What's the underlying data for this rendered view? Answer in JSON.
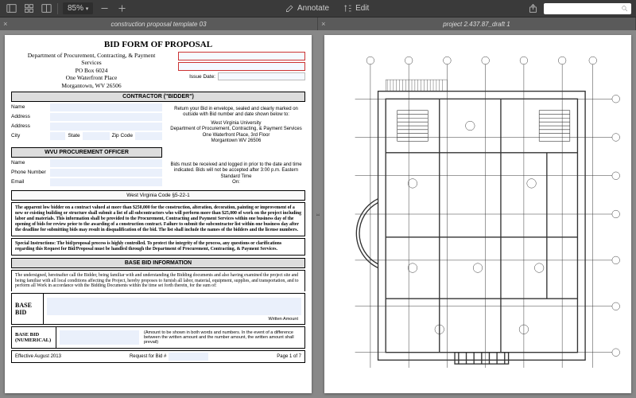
{
  "toolbar": {
    "zoom": "85%",
    "annotate": "Annotate",
    "edit": "Edit"
  },
  "tabs": [
    {
      "title": "construction proposal template 03"
    },
    {
      "title": "project 2.437.87_draft 1"
    }
  ],
  "doc": {
    "title": "BID FORM OF PROPOSAL",
    "dept_lines": [
      "Department of Procurement, Contracting, & Payment",
      "Services",
      "PO Box 6024",
      "One Waterfront Place",
      "Morgantown, WV 26506"
    ],
    "issue_date_label": "Issue Date:",
    "contractor_hdr": "CONTRACTOR (\"BIDDER\")",
    "labels": {
      "name": "Name",
      "address": "Address",
      "city": "City",
      "state": "State",
      "zip": "Zip Code",
      "phone": "Phone Number",
      "email": "Email"
    },
    "return_text": "Return your Bid in envelope, sealed and clearly marked on outside with Bid number and date shown below to:",
    "return_addr": [
      "West Virginia University",
      "Department of Procurement, Contracting, & Payment Services",
      "One Waterfront Place, 3rd Floor",
      "Morgantown WV 26506"
    ],
    "deadline_text": "Bids must be received and logged in prior to the date and time indicated.  Bids will not be accepted after 3:00 p.m. Eastern Standard Time",
    "deadline_on": "On:",
    "officer_hdr": "WVU PROCUREMENT OFFICER",
    "code": "West Virginia Code §5-22-1",
    "para1": "The apparent low bidder on a contract valued at more than $250,000 for the construction, alteration, decoration, painting or improvement of a new or existing building or structure shall submit a list of all subcontractors who will perform more than $25,000 of work on the project including labor and materials. This information shall be provided to the Procurement, Contracting and Payment Services within one business day of the opening of bids for review prior to the awarding of a construction contract. Failure to submit the subcontractor list within one business day after the deadline for submitting bids may result in disqualification of the bid. The list shall include the names of the bidders and the license numbers.",
    "para1b": "Special Instructions:  The bid/proposal process is highly controlled.   To protect the integrity of the process, any questions or clarifications regarding this Request for Bid/Proposal must be handled through the Department of Procurement, Contracting, & Payment Services.",
    "basebid_hdr": "BASE BID INFORMATION",
    "para2": "The undersigned, hereinafter call the Bidder, being familiar  with and understanding the Bidding documents and also having examined the project site and being familiar with all local conditions affecting the Project, hereby proposes to furnish all labor, material, equipment, supplies, and transportation, and to perform all Work in accordance with the Bidding Documents within the time set forth therein, for the sum of:",
    "base_lbl": "BASE",
    "bid_lbl": "BID",
    "written": "Written Amount",
    "numlbl": "BASE BID (NUMERICAL)",
    "numnote": "(Amount to be shown in both words and numbers. In the event of a difference between the written amount and the number amount, the written amount shall prevail)",
    "eff": "Effective August 2013",
    "reqlbl": "Request for Bid #",
    "pager": "Page 1 of 7"
  }
}
